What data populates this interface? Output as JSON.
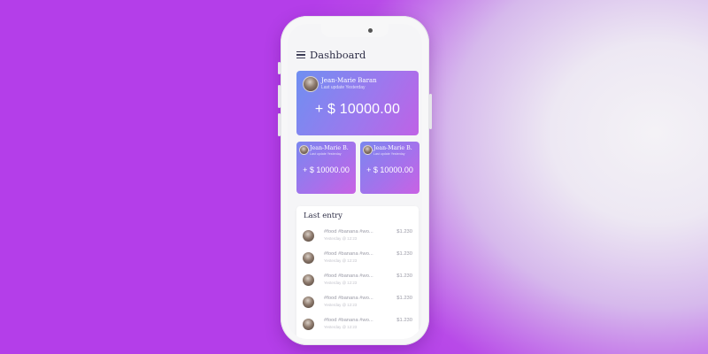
{
  "header": {
    "title": "Dashboard"
  },
  "main_card": {
    "name": "Jean-Marie Baran",
    "subtitle": "Last update Yesterday",
    "amount": "+ $ 10000.00"
  },
  "mini_cards": [
    {
      "name": "Jean-Marie B.",
      "subtitle": "Last update Yesterday",
      "amount": "+ $ 10000.00"
    },
    {
      "name": "Jean-Marie B.",
      "subtitle": "Last update Yesterday",
      "amount": "+ $ 10000.00"
    }
  ],
  "last_entry": {
    "title": "Last entry",
    "items": [
      {
        "tags": "#food #banana #wo...",
        "time": "Yesterday @ 12:23",
        "price": "$1.230"
      },
      {
        "tags": "#food #banana #wo...",
        "time": "Yesterday @ 12:23",
        "price": "$1.230"
      },
      {
        "tags": "#food #banana #wo...",
        "time": "Yesterday @ 12:23",
        "price": "$1.230"
      },
      {
        "tags": "#food #banana #wo...",
        "time": "Yesterday @ 12:23",
        "price": "$1.230"
      },
      {
        "tags": "#food #banana #wo...",
        "time": "Yesterday @ 12:23",
        "price": "$1.230"
      }
    ]
  },
  "icons": {
    "menu": "hamburger-menu-icon",
    "avatar": "user-avatar"
  },
  "colors": {
    "background_purple": "#b43ee9",
    "card_gradient_start": "#6f8ff1",
    "card_gradient_end": "#bf62e6",
    "title_text": "#2f2f47"
  }
}
